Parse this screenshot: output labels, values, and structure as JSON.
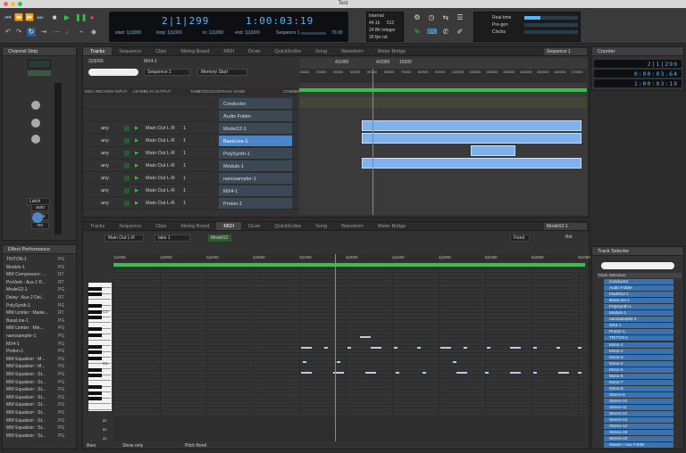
{
  "window": {
    "title": "Test"
  },
  "transport": {
    "counter_main": "2|1|299",
    "counter_time": "1:00:03:19",
    "start": "start: 1|1|000",
    "loop": "loop: 1|1|000",
    "in": "in: 1|1|000",
    "end": "end: 1|1|000",
    "sequence": "Sequence 1",
    "tempo": "70.00",
    "sync_internal": "Internal",
    "sample_rate": "44.1k",
    "buffer": "512",
    "bit_depth": "24 Bit Integer",
    "fps": "30 fps nd"
  },
  "status_labels": [
    "Real-time",
    "Pre-gen",
    "Clocks"
  ],
  "channel_strip": {
    "title": "Channel Strip",
    "buttons": [
      "auto",
      "mute",
      "rec"
    ],
    "latch": "Latch"
  },
  "effect_performance": {
    "title": "Effect Performance",
    "items": [
      {
        "name": "TRITON-1",
        "t": "PG"
      },
      {
        "name": "Modulo-1",
        "t": "PG"
      },
      {
        "name": "MW Compressor: ...",
        "t": "RT"
      },
      {
        "name": "ProVerb : Aux-1 R...",
        "t": "RT"
      },
      {
        "name": "Model12-1",
        "t": "PG"
      },
      {
        "name": "Delay : Aux-2 Del...",
        "t": "RT"
      },
      {
        "name": "PolySynth-1",
        "t": "PG"
      },
      {
        "name": "MW Limiter : Maste...",
        "t": "RT"
      },
      {
        "name": "BassLine-1",
        "t": "PG"
      },
      {
        "name": "MW Limiter : Min...",
        "t": "PG"
      },
      {
        "name": "nanosampler-1",
        "t": "PG"
      },
      {
        "name": "MX4-1",
        "t": "PG"
      },
      {
        "name": "Proton-1",
        "t": "PG"
      },
      {
        "name": "MW Equalizer : M...",
        "t": "PG"
      },
      {
        "name": "MW Equalizer : M...",
        "t": "PG"
      },
      {
        "name": "MW Equalizer : St...",
        "t": "PG"
      },
      {
        "name": "MW Equalizer : St...",
        "t": "PG"
      },
      {
        "name": "MW Equalizer : St...",
        "t": "PG"
      },
      {
        "name": "MW Equalizer : St...",
        "t": "PG"
      },
      {
        "name": "MW Equalizer : St...",
        "t": "PG"
      },
      {
        "name": "MW Equalizer : St...",
        "t": "PG"
      },
      {
        "name": "MW Equalizer : St...",
        "t": "PG"
      },
      {
        "name": "MW Equalizer : St...",
        "t": "PG"
      },
      {
        "name": "MW Equalizer : St...",
        "t": "PG"
      }
    ]
  },
  "main_tabs": [
    "Tracks",
    "Sequence",
    "Clips",
    "Mixing Board",
    "MIDI",
    "Drum",
    "QuickScribe",
    "Song",
    "Waveform",
    "Meter Bridge"
  ],
  "seq_header": {
    "position": "2|2|000",
    "name": "MX4-1",
    "sequence": "Sequence 1",
    "memory": "Memory Start",
    "seq_label": "Sequence 1"
  },
  "track_columns": [
    "MOV",
    "REC",
    "MON",
    "INPUT",
    "LEVEL",
    "PLAY",
    "OUTPUT",
    "TAKE",
    "STC",
    "CDI",
    "COL",
    "TRACK NAME",
    "COMMENTS"
  ],
  "ruler": {
    "snap": "4/1000",
    "zoom": "4/2000",
    "len": "15000",
    "marks": [
      "10000",
      "20000",
      "30000",
      "40000",
      "50000",
      "60000",
      "70000",
      "80000",
      "90000",
      "100000",
      "110000",
      "120000",
      "130000",
      "140000",
      "150000",
      "160000",
      "170000"
    ]
  },
  "tracks": [
    {
      "input": "",
      "output": "",
      "take": "",
      "name": "Conductor"
    },
    {
      "input": "",
      "output": "",
      "take": "",
      "name": "Audio Folder"
    },
    {
      "input": "any",
      "output": "Main Out L-R",
      "take": "1",
      "name": "Model12-1"
    },
    {
      "input": "any",
      "output": "Main Out L-R",
      "take": "1",
      "name": "BassLine-1"
    },
    {
      "input": "any",
      "output": "Main Out L-R",
      "take": "1",
      "name": "PolySynth-1"
    },
    {
      "input": "any",
      "output": "Main Out L-R",
      "take": "1",
      "name": "Modulo-1"
    },
    {
      "input": "any",
      "output": "Main Out L-R",
      "take": "1",
      "name": "nanosampler-1"
    },
    {
      "input": "any",
      "output": "Main Out L-R",
      "take": "1",
      "name": "MX4-1"
    },
    {
      "input": "any",
      "output": "Main Out L-R",
      "take": "1",
      "name": "Proton-1"
    }
  ],
  "midi_editor": {
    "output": "Main Out L-R",
    "take": "take 1",
    "track": "Model12",
    "mode": "Fixed",
    "seq_label": "Model12-1",
    "rel": "Rel",
    "ruler": [
      "1|1000",
      "1|4000",
      "2|1000",
      "2|4000",
      "3|1000",
      "3|4000",
      "4|1000",
      "4|4000",
      "5|1000",
      "5|4000",
      "6|1000"
    ],
    "key_labels": [
      "C2",
      "C1"
    ],
    "footer": {
      "bars": "Bars",
      "show": "Show only",
      "pitch": "Pitch Bend"
    },
    "vel_labels": [
      "80",
      "60",
      "40"
    ]
  },
  "counter_panel": {
    "title": "Counter",
    "values": [
      "2|1|299",
      "0:00:03.64",
      "1:00:03:19"
    ]
  },
  "track_selector": {
    "title": "Track Selector",
    "header": "Track Selection",
    "items": [
      "Conductor",
      "Audio Folder",
      "Model12-1",
      "BassLine-1",
      "PolySynth-1",
      "Modulo-1",
      "nanosampler-1",
      "MX4-1",
      "Proton-1",
      "TRITON-1",
      "Mono-1",
      "Mono-2",
      "Mono-3",
      "Mono-4",
      "Mono-5",
      "Mono-6",
      "Mono-7",
      "Mono-8",
      "Stereo-9",
      "Stereo-10",
      "Stereo-11",
      "Stereo-12",
      "Stereo-13",
      "Stereo-14",
      "Stereo-15",
      "Stereo-16",
      "Master / Aux Folder"
    ]
  },
  "colors": {
    "accent": "#4db8ff",
    "selection": "#3b73b1",
    "clip": "#7fb1ec",
    "playhead": "#36c24a"
  }
}
